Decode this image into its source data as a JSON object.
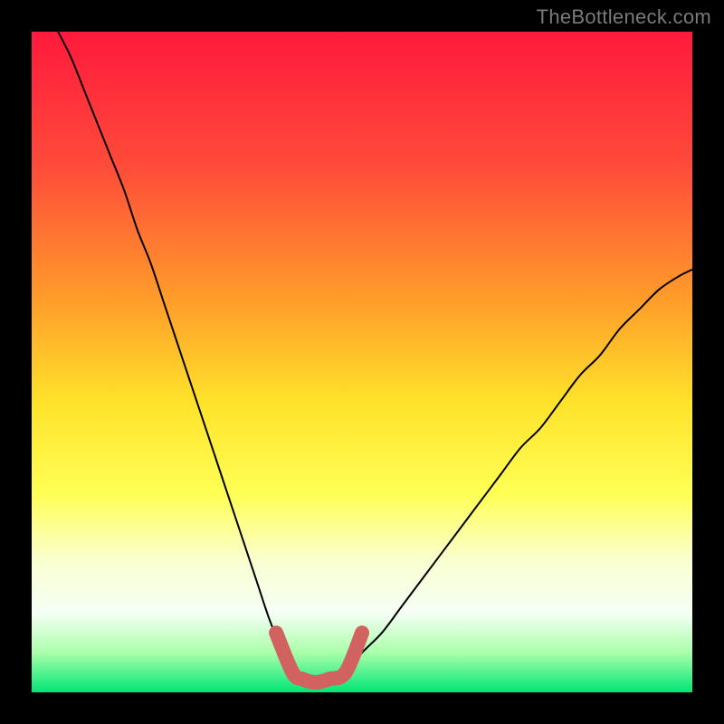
{
  "watermark": "TheBottleneck.com",
  "chart_data": {
    "type": "line",
    "title": "",
    "xlabel": "",
    "ylabel": "",
    "xlim": [
      0,
      100
    ],
    "ylim": [
      0,
      100
    ],
    "legend": false,
    "grid": false,
    "background_gradient_stops": [
      {
        "offset": 0.0,
        "color": "#ff1a3c"
      },
      {
        "offset": 0.2,
        "color": "#ff4a3a"
      },
      {
        "offset": 0.4,
        "color": "#ff9a2a"
      },
      {
        "offset": 0.56,
        "color": "#ffe22a"
      },
      {
        "offset": 0.7,
        "color": "#ffff55"
      },
      {
        "offset": 0.8,
        "color": "#faffd0"
      },
      {
        "offset": 0.88,
        "color": "#f5fff5"
      },
      {
        "offset": 0.94,
        "color": "#aaffaa"
      },
      {
        "offset": 1.0,
        "color": "#00e676"
      }
    ],
    "series": [
      {
        "name": "left-curve",
        "stroke": "#000000",
        "stroke_width": 2,
        "x": [
          4,
          6,
          8,
          10,
          12,
          14,
          16,
          18,
          20,
          22,
          24,
          26,
          28,
          30,
          32,
          34,
          36,
          38,
          39.5
        ],
        "y": [
          100,
          96,
          91,
          86,
          81,
          76,
          70,
          65,
          59,
          53,
          47,
          41,
          35,
          29,
          23,
          17,
          11,
          6,
          3
        ]
      },
      {
        "name": "right-curve",
        "stroke": "#000000",
        "stroke_width": 2,
        "x": [
          47.5,
          50,
          53,
          56,
          59,
          62,
          65,
          68,
          71,
          74,
          77,
          80,
          83,
          86,
          89,
          92,
          95,
          98,
          100
        ],
        "y": [
          3,
          6,
          9,
          13,
          17,
          21,
          25,
          29,
          33,
          37,
          40,
          44,
          48,
          51,
          55,
          58,
          61,
          63,
          64
        ]
      },
      {
        "name": "bottom-highlight",
        "stroke": "#d1625f",
        "stroke_width": 16,
        "linecap": "round",
        "x": [
          37,
          39.5,
          41,
          43,
          45,
          47.5,
          50
        ],
        "y": [
          9,
          3,
          2,
          1.5,
          2,
          3,
          9
        ]
      }
    ]
  }
}
